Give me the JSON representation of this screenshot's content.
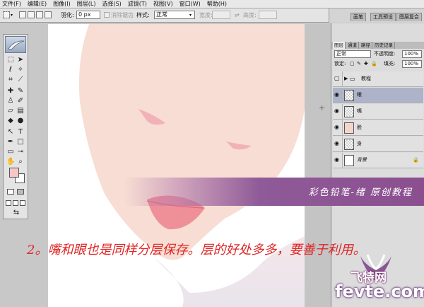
{
  "menu": [
    "文件(F)",
    "编辑(E)",
    "图像(I)",
    "图层(L)",
    "选择(S)",
    "滤镜(T)",
    "视图(V)",
    "窗口(W)",
    "帮助(H)"
  ],
  "options": {
    "feather_label": "羽化:",
    "feather_value": "0 px",
    "antialias_label": "消除锯齿",
    "style_label": "样式:",
    "style_value": "正常",
    "width_label": "宽度:",
    "height_label": "高度:"
  },
  "dock_tabs": [
    "画笔",
    "工具预设",
    "图层复合"
  ],
  "layers_panel": {
    "tabs": [
      "图层",
      "通道",
      "路径",
      "历史记录"
    ],
    "blend_mode": "正常",
    "opacity_label": "不透明度:",
    "opacity_value": "100%",
    "lock_label": "锁定:",
    "fill_label": "填充:",
    "fill_value": "100%",
    "layers": [
      {
        "name": "教程",
        "kind": "group"
      },
      {
        "name": "眼",
        "kind": "transparent"
      },
      {
        "name": "嘴",
        "kind": "transparent"
      },
      {
        "name": "脸",
        "kind": "skin"
      },
      {
        "name": "身",
        "kind": "transparent"
      },
      {
        "name": "背景",
        "kind": "background"
      }
    ],
    "selected_layer": "眼"
  },
  "overlay": {
    "banner_text": "彩色铅笔-绪 原创教程",
    "instruction": "2。嘴和眼也是同样分层保存。层的好处多多，要善于利用。",
    "watermark_cn": "飞特网",
    "watermark_en": "fevte.com"
  },
  "colors": {
    "foreground": "#f6c7c4",
    "background": "#ffffff",
    "skin": "#f7ddd3",
    "lips": "#ef8f98",
    "banner": "#8b4f8f",
    "instruction_text": "#e02525"
  }
}
